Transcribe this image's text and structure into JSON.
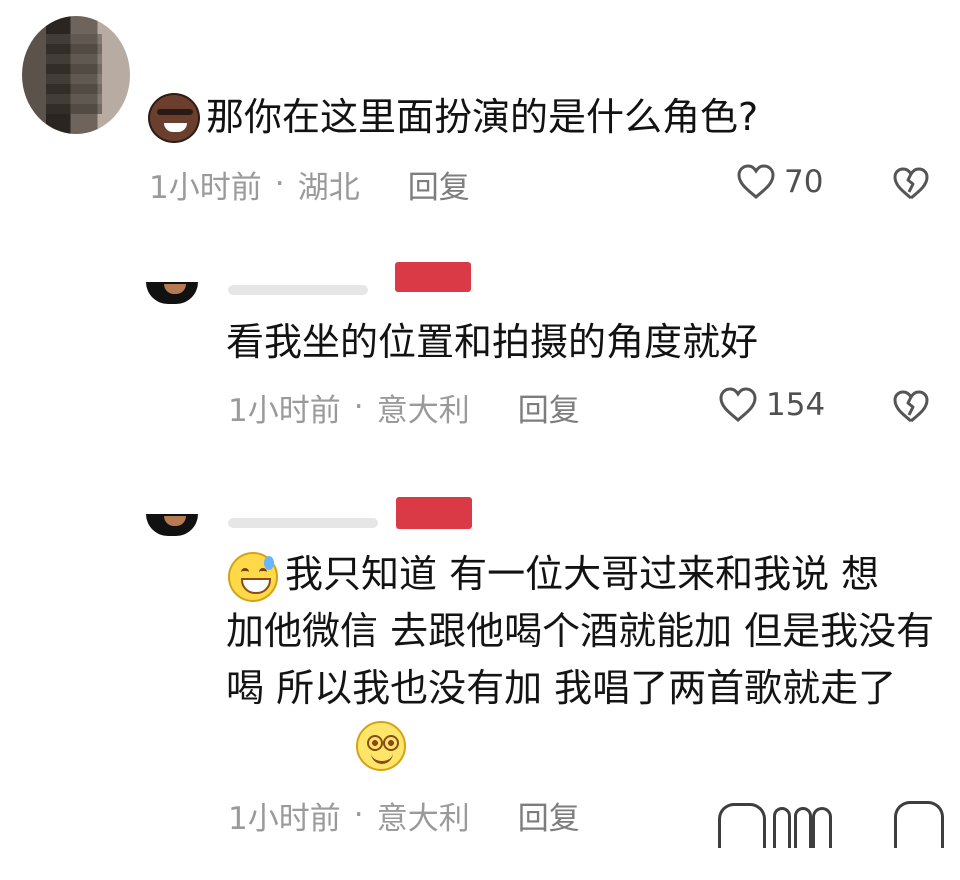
{
  "comments": [
    {
      "text": "那你在这里面扮演的是什么角色?",
      "time": "1小时前",
      "separator": "·",
      "location": "湖北",
      "reply_label": "回复",
      "likes": "70",
      "emoji": "smiling-face-with-sunglasses-icon"
    },
    {
      "text": "看我坐的位置和拍摄的角度就好",
      "time": "1小时前",
      "separator": "·",
      "location": "意大利",
      "reply_label": "回复",
      "likes": "154"
    },
    {
      "text_first_line": "我只知道 有一位大哥过来和我说 想",
      "text_rest": "加他微信 去跟他喝个酒就能加 但是我没有喝 所以我也没有加 我唱了两首歌就走了",
      "time": "1小时前",
      "separator": "·",
      "location": "意大利",
      "reply_label": "回复",
      "leading_emoji": "grinning-sweat-face-icon",
      "trailing_emoji": "smiling-face-icon"
    }
  ],
  "colors": {
    "text": "#121212",
    "meta": "#9a9a9a",
    "accent": "#d93a45",
    "background": "#ffffff"
  },
  "icons": {
    "like": "heart-outline-icon",
    "dislike": "broken-heart-outline-icon"
  }
}
